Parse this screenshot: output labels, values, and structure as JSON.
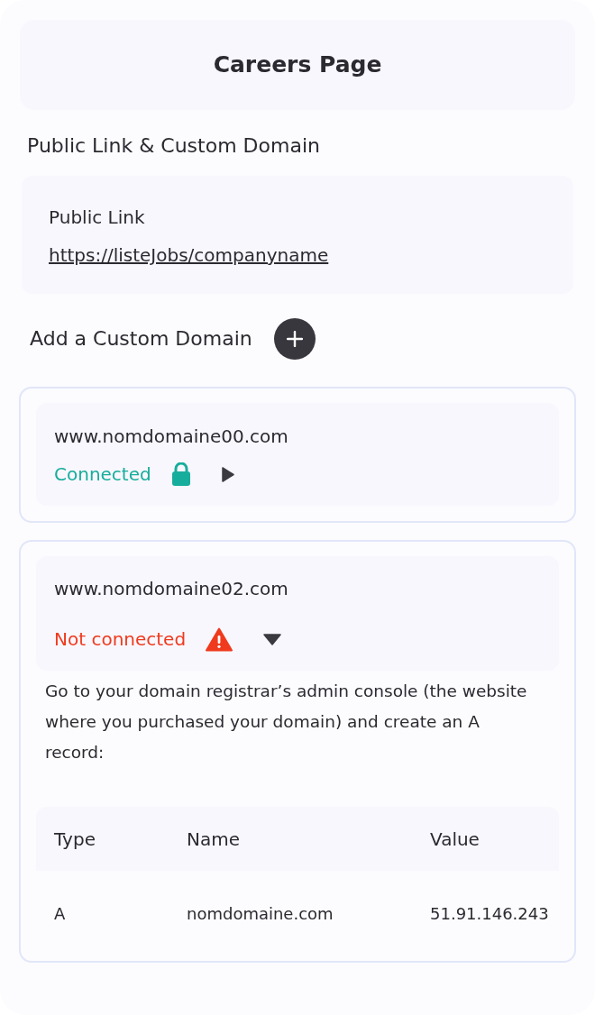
{
  "header": {
    "title": "Careers Page"
  },
  "section_title": "Public Link & Custom Domain",
  "public_link": {
    "label": "Public Link",
    "url": "https://listeJobs/companyname"
  },
  "add_domain": {
    "label": "Add a Custom Domain"
  },
  "domains": [
    {
      "domain": "www.nomdomaine00.com",
      "status": "Connected",
      "kind": "connected",
      "expanded": false
    },
    {
      "domain": "www.nomdomaine02.com",
      "status": "Not connected",
      "kind": "not_connected",
      "expanded": true,
      "instructions": "Go to your domain registrar’s admin console (the website where you purchased your domain) and create an A record:",
      "table": {
        "columns": [
          "Type",
          "Name",
          "Value"
        ],
        "rows": [
          [
            "A",
            "nomdomaine.com",
            "51.91.146.243"
          ]
        ]
      }
    }
  ]
}
